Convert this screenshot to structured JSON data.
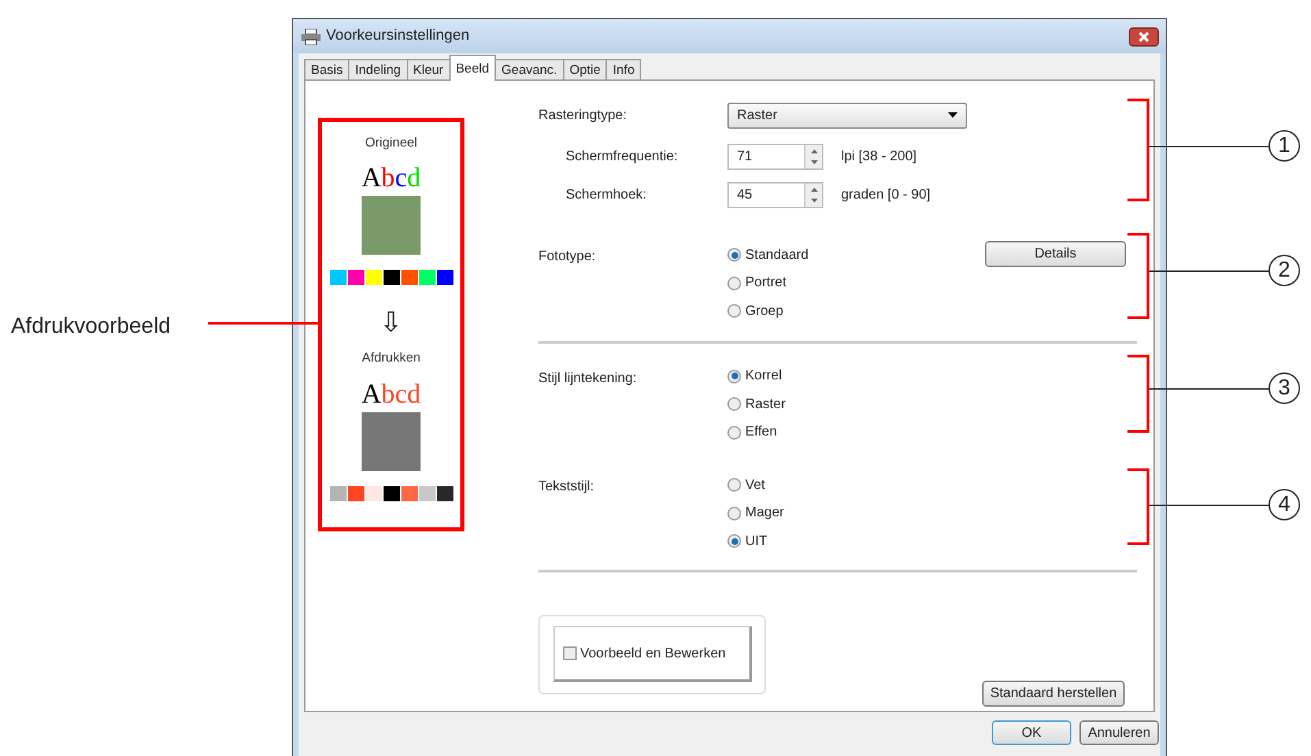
{
  "window": {
    "title": "Voorkeursinstellingen"
  },
  "tabs": [
    {
      "label": "Basis",
      "selected": false
    },
    {
      "label": "Indeling",
      "selected": false
    },
    {
      "label": "Kleur",
      "selected": false
    },
    {
      "label": "Beeld",
      "selected": true
    },
    {
      "label": "Geavanc.",
      "selected": false
    },
    {
      "label": "Optie",
      "selected": false
    },
    {
      "label": "Info",
      "selected": false
    }
  ],
  "preview": {
    "original": {
      "caption": "Origineel",
      "letters": [
        {
          "char": "A",
          "color": "#000000"
        },
        {
          "char": "b",
          "color": "#ff0000"
        },
        {
          "char": "c",
          "color": "#0000ff"
        },
        {
          "char": "d",
          "color": "#00dd00"
        }
      ],
      "swatches": [
        {
          "color": "#00c8ff"
        },
        {
          "color": "#ff00aa"
        },
        {
          "color": "#ffff00"
        },
        {
          "color": "#000000"
        },
        {
          "color": "#ff5000"
        },
        {
          "color": "#00ff66"
        },
        {
          "color": "#0000ff"
        }
      ]
    },
    "arrow": "⇩",
    "printed": {
      "caption": "Afdrukken",
      "letters": [
        {
          "char": "A",
          "color": "#000000"
        },
        {
          "char": "b",
          "color": "#ff4422"
        },
        {
          "char": "c",
          "color": "#ff4422"
        },
        {
          "char": "d",
          "color": "#ff4422"
        }
      ],
      "swatches": [
        {
          "color": "#b4b4b4"
        },
        {
          "color": "#ff4422"
        },
        {
          "color": "#ffe6e0"
        },
        {
          "color": "#000000"
        },
        {
          "color": "#ff6644"
        },
        {
          "color": "#c8c8c8"
        },
        {
          "color": "#282828"
        }
      ]
    }
  },
  "screening": {
    "type_label": "Rasteringtype:",
    "type_value": "Raster",
    "fields": [
      {
        "label": "Schermfrequentie:",
        "value": "71",
        "range": "lpi [38 - 200]"
      },
      {
        "label": "Schermhoek:",
        "value": "45",
        "range": "graden [0 - 90]"
      }
    ]
  },
  "groups": [
    {
      "label": "Fototype:",
      "button": "Details",
      "divider_after": true,
      "options": [
        {
          "label": "Standaard",
          "selected": true
        },
        {
          "label": "Portret",
          "selected": false
        },
        {
          "label": "Groep",
          "selected": false
        }
      ]
    },
    {
      "label": "Stijl lijntekening:",
      "divider_after": false,
      "options": [
        {
          "label": "Korrel",
          "selected": true
        },
        {
          "label": "Raster",
          "selected": false
        },
        {
          "label": "Effen",
          "selected": false
        }
      ]
    },
    {
      "label": "Tekststijl:",
      "divider_after": true,
      "options": [
        {
          "label": "Vet",
          "selected": false
        },
        {
          "label": "Mager",
          "selected": false
        },
        {
          "label": "UIT",
          "selected": true
        }
      ]
    }
  ],
  "preview_edit": {
    "label": "Voorbeeld en Bewerken",
    "checked": false
  },
  "reset_button": "Standaard herstellen",
  "buttons": [
    {
      "label": "OK",
      "default": true
    },
    {
      "label": "Annuleren",
      "default": false
    }
  ],
  "annotations": {
    "preview_label": "Afdrukvoorbeeld",
    "callouts": [
      "1",
      "2",
      "3",
      "4"
    ]
  }
}
